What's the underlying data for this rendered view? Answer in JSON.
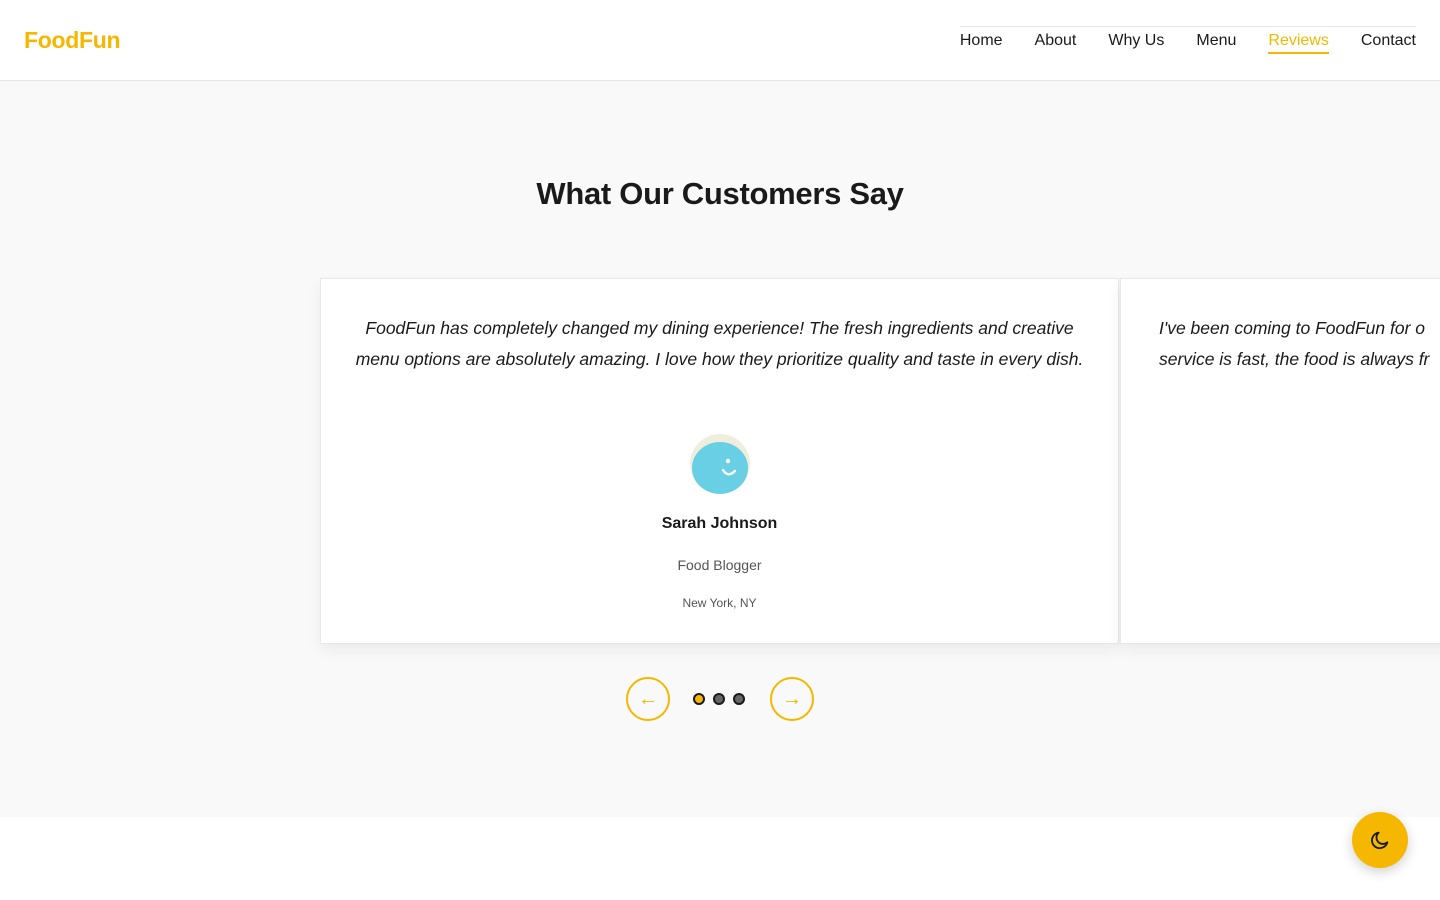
{
  "brand": {
    "name": "FoodFun",
    "accent_color": "#f5b700"
  },
  "scroll_progress_percent": 79,
  "nav": {
    "items": [
      {
        "label": "Home",
        "active": false
      },
      {
        "label": "About",
        "active": false
      },
      {
        "label": "Why Us",
        "active": false
      },
      {
        "label": "Menu",
        "active": false
      },
      {
        "label": "Reviews",
        "active": true
      },
      {
        "label": "Contact",
        "active": false
      }
    ]
  },
  "reviews": {
    "title": "What Our Customers Say",
    "testimonials": [
      {
        "quote": "FoodFun has completely changed my dining experience! The fresh ingredients and creative menu options are absolutely amazing. I love how they prioritize quality and taste in every dish.",
        "name": "Sarah Johnson",
        "role": "Food Blogger",
        "location": "New York, NY",
        "avatar_icon": "smiling-face-avatar"
      },
      {
        "quote_line1": "I've been coming to FoodFun for o",
        "quote_line2": "service is fast, the food is always fr"
      }
    ],
    "carousel": {
      "prev_label": "←",
      "next_label": "→",
      "slide_count": 3,
      "active_index": 0
    }
  },
  "theme_toggle": {
    "icon": "moon-icon"
  }
}
